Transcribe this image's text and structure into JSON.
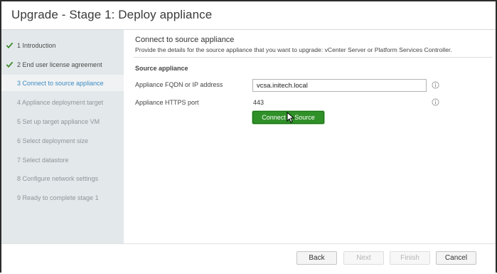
{
  "window": {
    "title": "Upgrade - Stage 1: Deploy appliance"
  },
  "steps": [
    {
      "label": "1 Introduction",
      "state": "done"
    },
    {
      "label": "2 End user license agreement",
      "state": "done"
    },
    {
      "label": "3 Connect to source appliance",
      "state": "active"
    },
    {
      "label": "4 Appliance deployment target",
      "state": "pending"
    },
    {
      "label": "5 Set up target appliance VM",
      "state": "pending"
    },
    {
      "label": "6 Select deployment size",
      "state": "pending"
    },
    {
      "label": "7 Select datastore",
      "state": "pending"
    },
    {
      "label": "8 Configure network settings",
      "state": "pending"
    },
    {
      "label": "9 Ready to complete stage 1",
      "state": "pending"
    }
  ],
  "content": {
    "title": "Connect to source appliance",
    "description": "Provide the details for the source appliance that you want to upgrade: vCenter Server or Platform Services Controller.",
    "section_title": "Source appliance",
    "fqdn_label": "Appliance FQDN or IP address",
    "fqdn_value": "vcsa.initech.local",
    "port_label": "Appliance HTTPS port",
    "port_value": "443",
    "connect_button": "Connect to Source"
  },
  "footer": {
    "back": "Back",
    "next": "Next",
    "finish": "Finish",
    "cancel": "Cancel"
  },
  "colors": {
    "accent_green": "#2f9028",
    "active_step": "#3d8cc4",
    "sidebar_bg": "#e3e8ea",
    "check_green": "#3c8b2e"
  },
  "icons": {
    "done_step": "checkmark-icon",
    "field_help": "info-icon",
    "pointer": "mouse-pointer-icon"
  }
}
